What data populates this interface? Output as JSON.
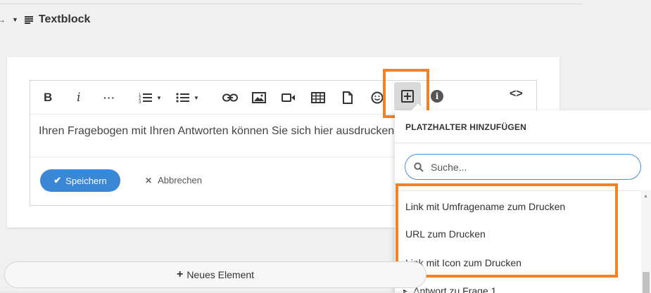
{
  "header": {
    "title": "Textblock",
    "collapse_icon": "caret-down-icon",
    "type_icon": "text-lines-icon"
  },
  "toolbar": {
    "bold": "B",
    "italic": "i",
    "more": "···",
    "code": "<>",
    "info": "i"
  },
  "editor": {
    "content": "Ihren Fragebogen mit Ihren Antworten können Sie sich hier ausdrucken."
  },
  "actions": {
    "save_label": "Speichern",
    "cancel_label": "Abbrechen"
  },
  "placeholder_menu": {
    "title": "PLATZHALTER HINZUFÜGEN",
    "search_placeholder": "Suche...",
    "items": [
      {
        "label": "Link mit Umfragename zum Drucken"
      },
      {
        "label": "URL zum Drucken"
      },
      {
        "label": "Link mit Icon zum Drucken"
      }
    ],
    "tree_item": "Antwort zu Frage 1"
  },
  "footer": {
    "new_element_label": "Neues Element"
  },
  "colors": {
    "accent": "#3a87d6",
    "highlight": "#f0832a"
  }
}
